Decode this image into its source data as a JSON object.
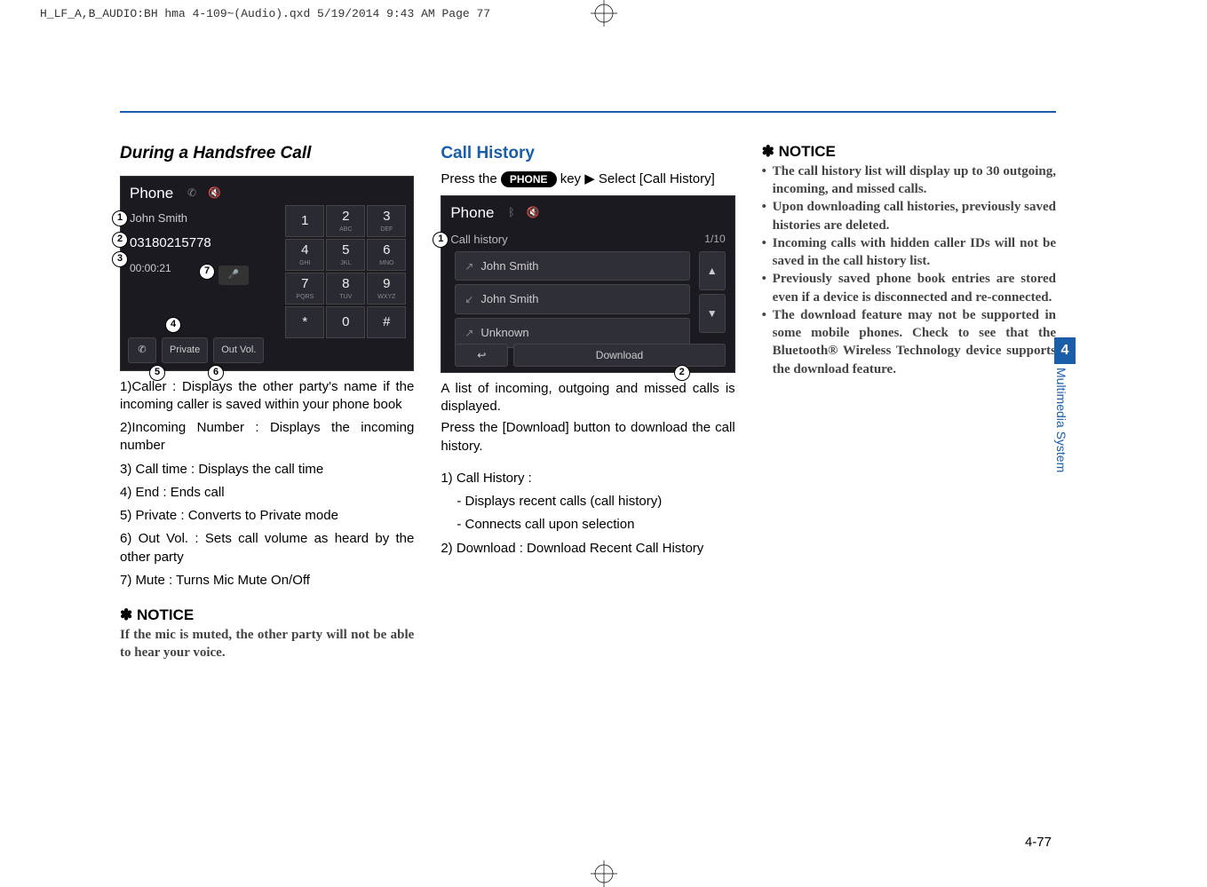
{
  "print_header": "H_LF_A,B_AUDIO:BH hma 4-109~(Audio).qxd  5/19/2014  9:43 AM  Page 77",
  "col1": {
    "heading": "During a Handsfree Call",
    "phone_screen": {
      "title": "Phone",
      "caller": "John Smith",
      "number": "03180215778",
      "time": "00:00:21",
      "private": "Private",
      "outvol": "Out Vol.",
      "keys": [
        "1",
        "2",
        "3",
        "4",
        "5",
        "6",
        "7",
        "8",
        "9",
        "*",
        "0",
        "#"
      ],
      "key_sub": [
        "",
        "ABC",
        "DEF",
        "GHI",
        "JKL",
        "MNO",
        "PQRS",
        "TUV",
        "WXYZ",
        "",
        "",
        ""
      ]
    },
    "items": [
      "1)Caller : Displays the other party's name if the incoming caller is saved within your phone book",
      "2)Incoming Number : Displays the incoming number",
      "3) Call time : Displays the call time",
      "4) End : Ends call",
      "5) Private : Converts to Private mode",
      "6) Out Vol. : Sets call volume as heard by the other party",
      "7) Mute : Turns Mic Mute On/Off"
    ],
    "notice_h": "NOTICE",
    "notice_body": "If the mic is muted, the other party will not be able to hear your voice."
  },
  "col2": {
    "heading": "Call History",
    "intro_pre": "Press the ",
    "key_label": "PHONE",
    "intro_post": " key ▶ Select [Call History]",
    "phone_screen": {
      "title": "Phone",
      "subtitle": "Call history",
      "count": "1/10",
      "rows": [
        "John Smith",
        "John Smith",
        "Unknown"
      ],
      "download": "Download"
    },
    "p1": "A list of incoming, outgoing and missed calls is displayed.",
    "p2": "Press the [Download] button to download the call history.",
    "items": [
      "1) Call History :",
      "- Displays recent calls (call history)",
      "- Connects call upon selection",
      "2) Download : Download Recent Call History"
    ]
  },
  "col3": {
    "notice_h": "NOTICE",
    "bullets": [
      "The call history list will display up to 30 outgoing, incoming, and missed calls.",
      "Upon downloading call histories, previously saved histories are deleted.",
      "Incoming calls with hidden caller IDs will not be saved in the call history list.",
      " Previously saved phone book entries are stored even if a device is disconnected and re-connected.",
      "The download feature may not be supported in some mobile phones. Check to see that the Bluetooth®  Wireless Technology device supports the download feature."
    ]
  },
  "sidebar": {
    "num": "4",
    "label": "Multimedia System"
  },
  "footer": "4-77"
}
